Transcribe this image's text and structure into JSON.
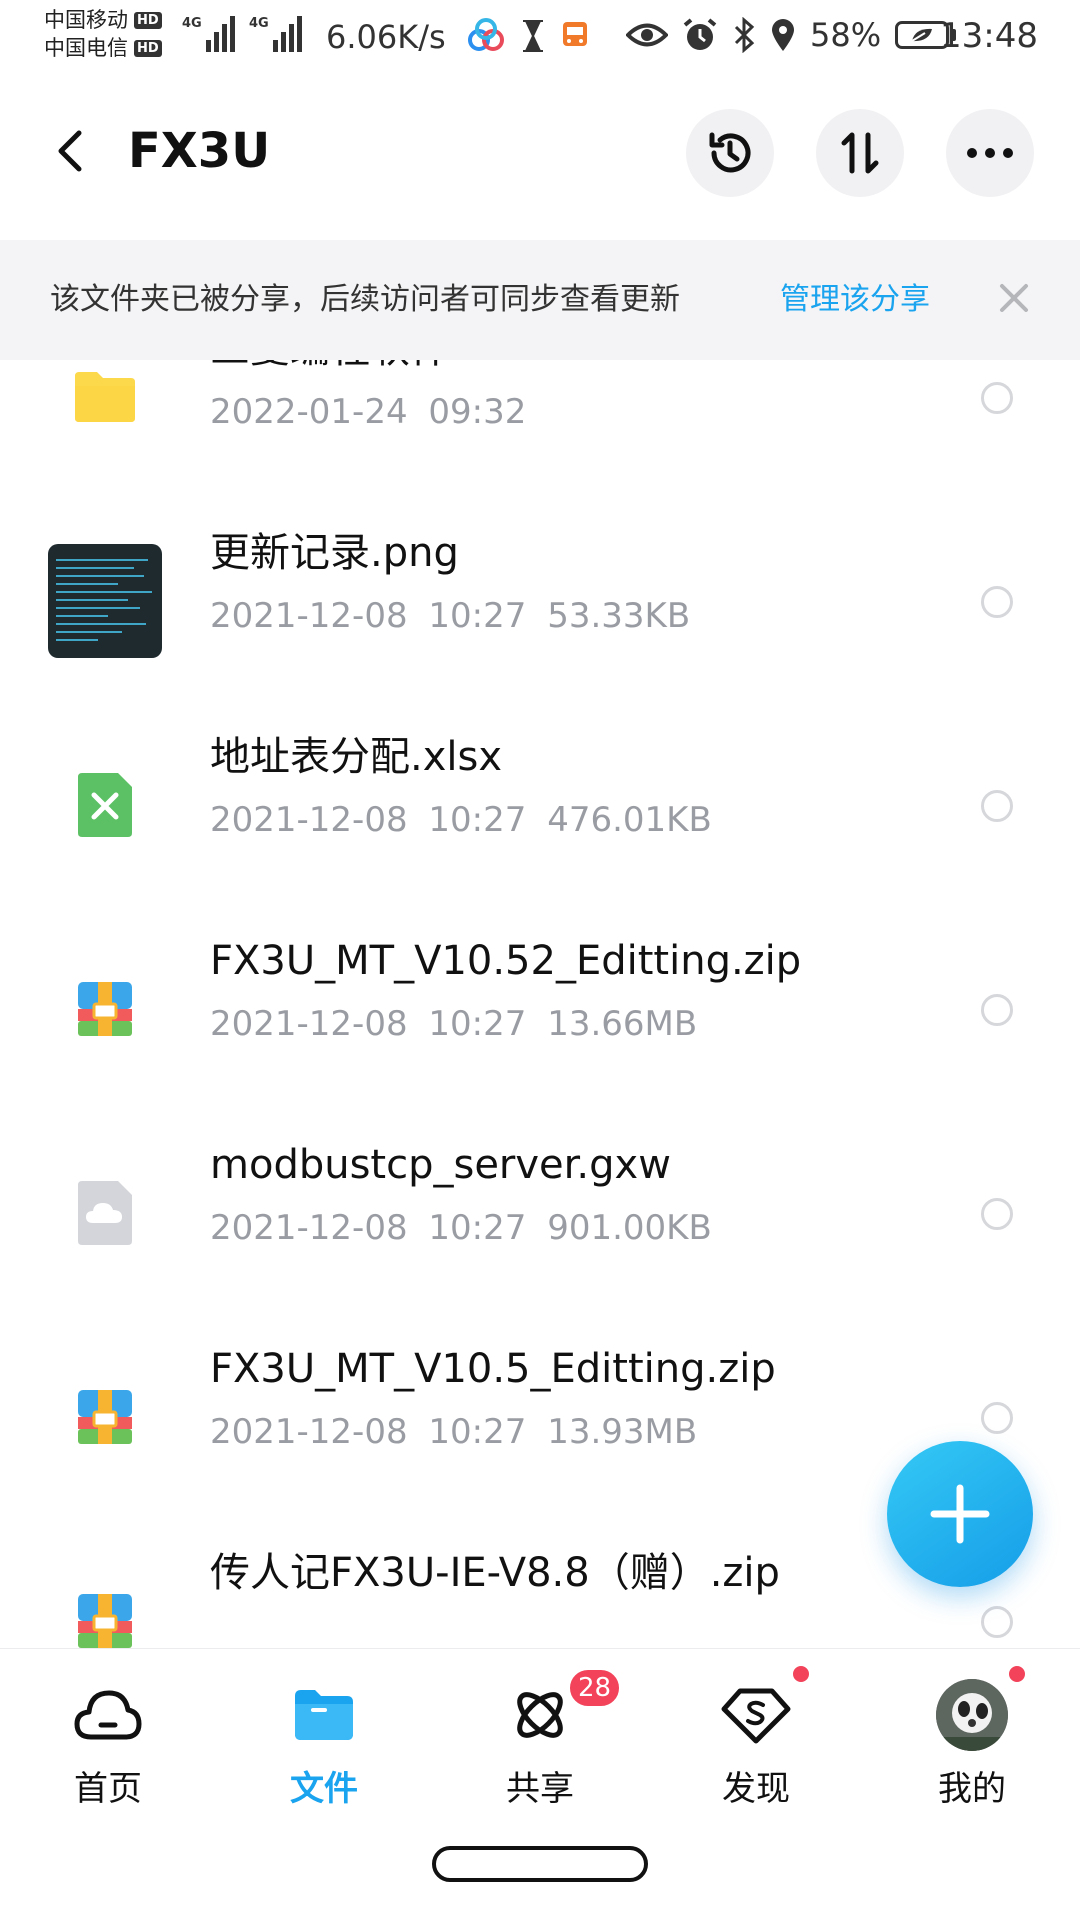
{
  "status_bar": {
    "carrier_1": "中国移动",
    "carrier_2": "中国电信",
    "hd": "HD",
    "network_1": "4G",
    "network_2": "4G",
    "net_speed": "6.06K/s",
    "battery": "58%",
    "time": "13:48"
  },
  "header": {
    "title": "FX3U"
  },
  "banner": {
    "text": "该文件夹已被分享，后续访问者可同步查看更新",
    "link": "管理该分享"
  },
  "files": [
    {
      "name": "三菱编程软件",
      "date": "2022-01-24",
      "time": "09:32",
      "size": "",
      "type": "folder"
    },
    {
      "name": "更新记录.png",
      "date": "2021-12-08",
      "time": "10:27",
      "size": "53.33KB",
      "type": "image"
    },
    {
      "name": "地址表分配.xlsx",
      "date": "2021-12-08",
      "time": "10:27",
      "size": "476.01KB",
      "type": "excel"
    },
    {
      "name": "FX3U_MT_V10.52_Editting.zip",
      "date": "2021-12-08",
      "time": "10:27",
      "size": "13.66MB",
      "type": "zip"
    },
    {
      "name": "modbustcp_server.gxw",
      "date": "2021-12-08",
      "time": "10:27",
      "size": "901.00KB",
      "type": "unknown"
    },
    {
      "name": "FX3U_MT_V10.5_Editting.zip",
      "date": "2021-12-08",
      "time": "10:27",
      "size": "13.93MB",
      "type": "zip"
    },
    {
      "name": "传人记FX3U-IE-V8.8（赠）.zip",
      "date": "",
      "time": "",
      "size": "",
      "type": "zip"
    }
  ],
  "bottom_nav": {
    "items": [
      {
        "label": "首页",
        "icon": "cloud-icon"
      },
      {
        "label": "文件",
        "icon": "folder-icon"
      },
      {
        "label": "共享",
        "icon": "share-atom-icon",
        "badge": "28"
      },
      {
        "label": "发现",
        "icon": "discover-icon"
      },
      {
        "label": "我的",
        "icon": "avatar"
      }
    ],
    "active_index": 1
  },
  "colors": {
    "accent": "#1aa3ee",
    "badge": "#f2435a",
    "meta_text": "#9a9ca3",
    "folder": "#fcd84b",
    "excel": "#5cc164"
  }
}
